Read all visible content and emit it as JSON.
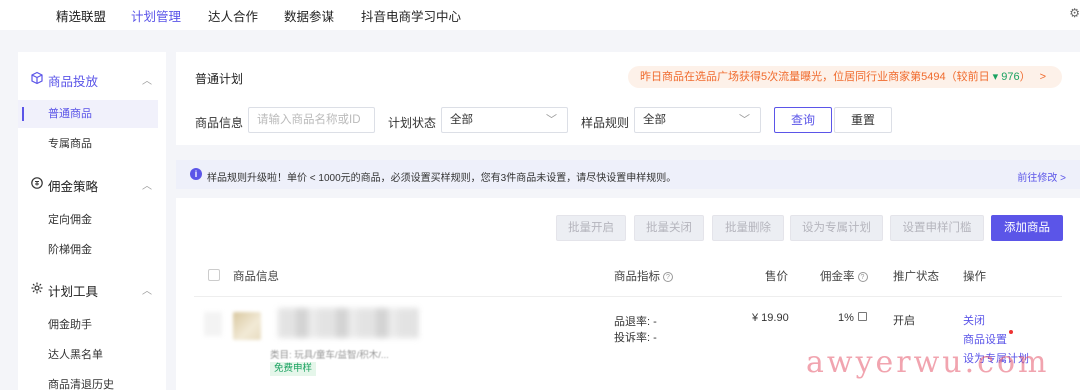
{
  "topnav": {
    "items": [
      "精选联盟",
      "计划管理",
      "达人合作",
      "数据参谋",
      "抖音电商学习中心"
    ],
    "active_index": 1
  },
  "sidebar": {
    "groups": [
      {
        "label": "商品投放",
        "icon": "cube-icon",
        "active": true,
        "items": [
          "普通商品",
          "专属商品"
        ]
      },
      {
        "label": "佣金策略",
        "icon": "coin-icon",
        "items": [
          "定向佣金",
          "阶梯佣金"
        ]
      },
      {
        "label": "计划工具",
        "icon": "gear-icon",
        "items": [
          "佣金助手",
          "达人黑名单",
          "商品清退历史"
        ]
      }
    ],
    "active_item": "普通商品"
  },
  "filter": {
    "title": "普通计划",
    "promo": {
      "text": "昨日商品在选品广场获得5次流量曝光，位居同行业商家第5494（较前日 ",
      "delta": "▾ 976",
      "tail": "）",
      "arrow": ">"
    },
    "product_info_label": "商品信息",
    "product_info_placeholder": "请输入商品名称或ID",
    "plan_status_label": "计划状态",
    "plan_status_value": "全部",
    "sample_rule_label": "样品规则",
    "sample_rule_value": "全部",
    "query_label": "查询",
    "reset_label": "重置"
  },
  "notice": {
    "text": "样品规则升级啦！单价 < 1000元的商品，必须设置买样规则，您有3件商品未设置，请尽快设置申样规则。",
    "link": "前往修改 >"
  },
  "toolbar": {
    "batch_enable": "批量开启",
    "batch_close": "批量关闭",
    "batch_delete": "批量删除",
    "set_exclusive": "设为专属计划",
    "set_threshold": "设置申样门槛",
    "add_product": "添加商品"
  },
  "table": {
    "headers": {
      "info": "商品信息",
      "metrics": "商品指标",
      "price": "售价",
      "commission": "佣金率",
      "status": "推广状态",
      "actions": "操作"
    },
    "rows": [
      {
        "category": "类目: 玩具/童车/益智/积木/...",
        "tag": "免费申样",
        "return_rate": "品退率: -",
        "complaint_rate": "投诉率: -",
        "price": "¥ 19.90",
        "commission": "1%",
        "status": "开启",
        "actions": [
          "关闭",
          "商品设置",
          "设为专属计划"
        ]
      }
    ]
  },
  "watermark": "awyerwu.com",
  "colors": {
    "accent": "#5b55e8",
    "promo": "#f06b2e",
    "success": "#1aa260"
  }
}
